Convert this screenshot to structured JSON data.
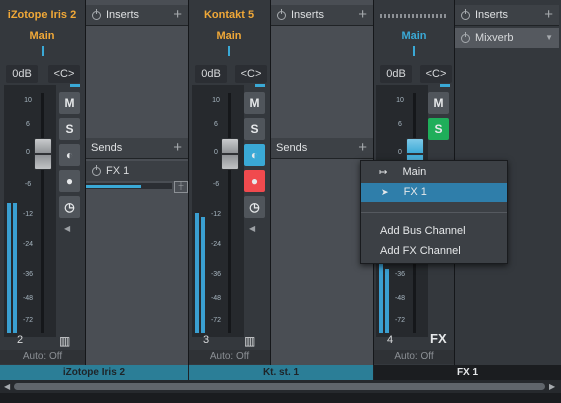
{
  "channels": [
    {
      "name": "iZotope Iris 2",
      "output": "Main",
      "gain": "0dB",
      "pan": "<C>",
      "number": "2",
      "automation": "Auto: Off",
      "bottom_label": "iZotope Iris 2"
    },
    {
      "name": "Kontakt 5",
      "output": "Main",
      "gain": "0dB",
      "pan": "<C>",
      "number": "3",
      "automation": "Auto: Off",
      "bottom_label": "Kt. st. 1"
    },
    {
      "name": "",
      "output": "Main",
      "gain": "0dB",
      "pan": "<C>",
      "number": "4",
      "automation": "Auto: Off",
      "bottom_label": "FX 1",
      "type_badge": "FX"
    }
  ],
  "inserts_label": "Inserts",
  "sends_label": "Sends",
  "send_fx1": "FX 1",
  "plugin_mixverb": "Mixverb",
  "buttons": {
    "mute": "M",
    "solo": "S"
  },
  "scale": [
    "10",
    "6",
    "0",
    "-6",
    "-12",
    "-24",
    "-36",
    "-48",
    "-72"
  ],
  "context_menu": {
    "main": "Main",
    "fx1": "FX 1",
    "add_bus": "Add Bus Channel",
    "add_fx": "Add FX Channel"
  },
  "colors": {
    "accent_blue": "#3aa9d6",
    "orange": "#f0a838",
    "record_red": "#f04a4e",
    "solo_green": "#1fae5a",
    "selected": "#2f7eaa"
  }
}
